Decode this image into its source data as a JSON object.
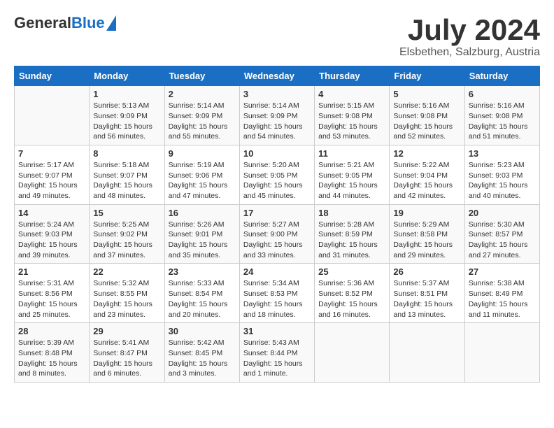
{
  "header": {
    "logo_general": "General",
    "logo_blue": "Blue",
    "month_year": "July 2024",
    "location": "Elsbethen, Salzburg, Austria"
  },
  "weekdays": [
    "Sunday",
    "Monday",
    "Tuesday",
    "Wednesday",
    "Thursday",
    "Friday",
    "Saturday"
  ],
  "weeks": [
    [
      {
        "day": "",
        "lines": []
      },
      {
        "day": "1",
        "lines": [
          "Sunrise: 5:13 AM",
          "Sunset: 9:09 PM",
          "Daylight: 15 hours",
          "and 56 minutes."
        ]
      },
      {
        "day": "2",
        "lines": [
          "Sunrise: 5:14 AM",
          "Sunset: 9:09 PM",
          "Daylight: 15 hours",
          "and 55 minutes."
        ]
      },
      {
        "day": "3",
        "lines": [
          "Sunrise: 5:14 AM",
          "Sunset: 9:09 PM",
          "Daylight: 15 hours",
          "and 54 minutes."
        ]
      },
      {
        "day": "4",
        "lines": [
          "Sunrise: 5:15 AM",
          "Sunset: 9:08 PM",
          "Daylight: 15 hours",
          "and 53 minutes."
        ]
      },
      {
        "day": "5",
        "lines": [
          "Sunrise: 5:16 AM",
          "Sunset: 9:08 PM",
          "Daylight: 15 hours",
          "and 52 minutes."
        ]
      },
      {
        "day": "6",
        "lines": [
          "Sunrise: 5:16 AM",
          "Sunset: 9:08 PM",
          "Daylight: 15 hours",
          "and 51 minutes."
        ]
      }
    ],
    [
      {
        "day": "7",
        "lines": [
          "Sunrise: 5:17 AM",
          "Sunset: 9:07 PM",
          "Daylight: 15 hours",
          "and 49 minutes."
        ]
      },
      {
        "day": "8",
        "lines": [
          "Sunrise: 5:18 AM",
          "Sunset: 9:07 PM",
          "Daylight: 15 hours",
          "and 48 minutes."
        ]
      },
      {
        "day": "9",
        "lines": [
          "Sunrise: 5:19 AM",
          "Sunset: 9:06 PM",
          "Daylight: 15 hours",
          "and 47 minutes."
        ]
      },
      {
        "day": "10",
        "lines": [
          "Sunrise: 5:20 AM",
          "Sunset: 9:05 PM",
          "Daylight: 15 hours",
          "and 45 minutes."
        ]
      },
      {
        "day": "11",
        "lines": [
          "Sunrise: 5:21 AM",
          "Sunset: 9:05 PM",
          "Daylight: 15 hours",
          "and 44 minutes."
        ]
      },
      {
        "day": "12",
        "lines": [
          "Sunrise: 5:22 AM",
          "Sunset: 9:04 PM",
          "Daylight: 15 hours",
          "and 42 minutes."
        ]
      },
      {
        "day": "13",
        "lines": [
          "Sunrise: 5:23 AM",
          "Sunset: 9:03 PM",
          "Daylight: 15 hours",
          "and 40 minutes."
        ]
      }
    ],
    [
      {
        "day": "14",
        "lines": [
          "Sunrise: 5:24 AM",
          "Sunset: 9:03 PM",
          "Daylight: 15 hours",
          "and 39 minutes."
        ]
      },
      {
        "day": "15",
        "lines": [
          "Sunrise: 5:25 AM",
          "Sunset: 9:02 PM",
          "Daylight: 15 hours",
          "and 37 minutes."
        ]
      },
      {
        "day": "16",
        "lines": [
          "Sunrise: 5:26 AM",
          "Sunset: 9:01 PM",
          "Daylight: 15 hours",
          "and 35 minutes."
        ]
      },
      {
        "day": "17",
        "lines": [
          "Sunrise: 5:27 AM",
          "Sunset: 9:00 PM",
          "Daylight: 15 hours",
          "and 33 minutes."
        ]
      },
      {
        "day": "18",
        "lines": [
          "Sunrise: 5:28 AM",
          "Sunset: 8:59 PM",
          "Daylight: 15 hours",
          "and 31 minutes."
        ]
      },
      {
        "day": "19",
        "lines": [
          "Sunrise: 5:29 AM",
          "Sunset: 8:58 PM",
          "Daylight: 15 hours",
          "and 29 minutes."
        ]
      },
      {
        "day": "20",
        "lines": [
          "Sunrise: 5:30 AM",
          "Sunset: 8:57 PM",
          "Daylight: 15 hours",
          "and 27 minutes."
        ]
      }
    ],
    [
      {
        "day": "21",
        "lines": [
          "Sunrise: 5:31 AM",
          "Sunset: 8:56 PM",
          "Daylight: 15 hours",
          "and 25 minutes."
        ]
      },
      {
        "day": "22",
        "lines": [
          "Sunrise: 5:32 AM",
          "Sunset: 8:55 PM",
          "Daylight: 15 hours",
          "and 23 minutes."
        ]
      },
      {
        "day": "23",
        "lines": [
          "Sunrise: 5:33 AM",
          "Sunset: 8:54 PM",
          "Daylight: 15 hours",
          "and 20 minutes."
        ]
      },
      {
        "day": "24",
        "lines": [
          "Sunrise: 5:34 AM",
          "Sunset: 8:53 PM",
          "Daylight: 15 hours",
          "and 18 minutes."
        ]
      },
      {
        "day": "25",
        "lines": [
          "Sunrise: 5:36 AM",
          "Sunset: 8:52 PM",
          "Daylight: 15 hours",
          "and 16 minutes."
        ]
      },
      {
        "day": "26",
        "lines": [
          "Sunrise: 5:37 AM",
          "Sunset: 8:51 PM",
          "Daylight: 15 hours",
          "and 13 minutes."
        ]
      },
      {
        "day": "27",
        "lines": [
          "Sunrise: 5:38 AM",
          "Sunset: 8:49 PM",
          "Daylight: 15 hours",
          "and 11 minutes."
        ]
      }
    ],
    [
      {
        "day": "28",
        "lines": [
          "Sunrise: 5:39 AM",
          "Sunset: 8:48 PM",
          "Daylight: 15 hours",
          "and 8 minutes."
        ]
      },
      {
        "day": "29",
        "lines": [
          "Sunrise: 5:41 AM",
          "Sunset: 8:47 PM",
          "Daylight: 15 hours",
          "and 6 minutes."
        ]
      },
      {
        "day": "30",
        "lines": [
          "Sunrise: 5:42 AM",
          "Sunset: 8:45 PM",
          "Daylight: 15 hours",
          "and 3 minutes."
        ]
      },
      {
        "day": "31",
        "lines": [
          "Sunrise: 5:43 AM",
          "Sunset: 8:44 PM",
          "Daylight: 15 hours",
          "and 1 minute."
        ]
      },
      {
        "day": "",
        "lines": []
      },
      {
        "day": "",
        "lines": []
      },
      {
        "day": "",
        "lines": []
      }
    ]
  ]
}
